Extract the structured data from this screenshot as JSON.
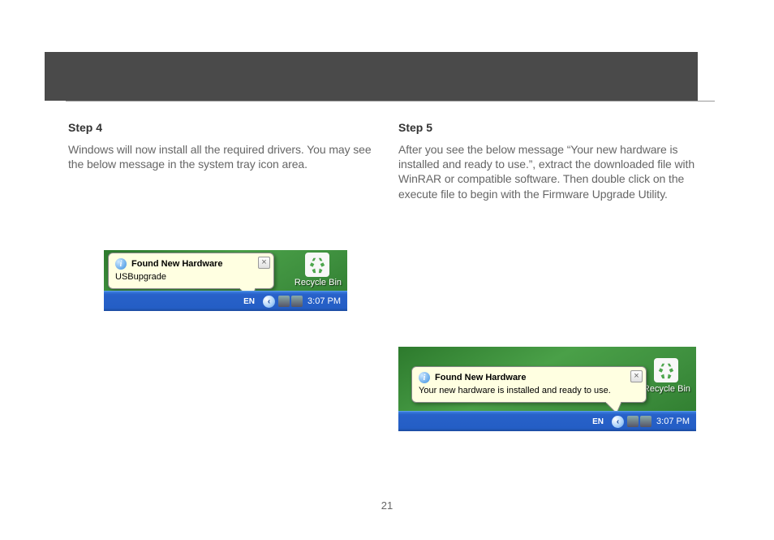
{
  "page_number": "21",
  "step4": {
    "title": "Step 4",
    "body": "Windows will now install all the required drivers. You may see the below message in the system tray icon area.",
    "balloon": {
      "title": "Found New Hardware",
      "text": "USBupgrade"
    },
    "recycle_label": "Recycle Bin",
    "lang": "EN",
    "time": "3:07 PM"
  },
  "step5": {
    "title": "Step 5",
    "body": "After you see the below message “Your new hardware is installed and ready to use.”, extract the downloaded file with WinRAR or compatible software. Then double click on the execute file to begin with the Firmware Upgrade Utility.",
    "balloon": {
      "title": "Found New Hardware",
      "text": "Your new hardware is installed and ready to use."
    },
    "recycle_label": "Recycle Bin",
    "lang": "EN",
    "time": "3:07 PM"
  }
}
